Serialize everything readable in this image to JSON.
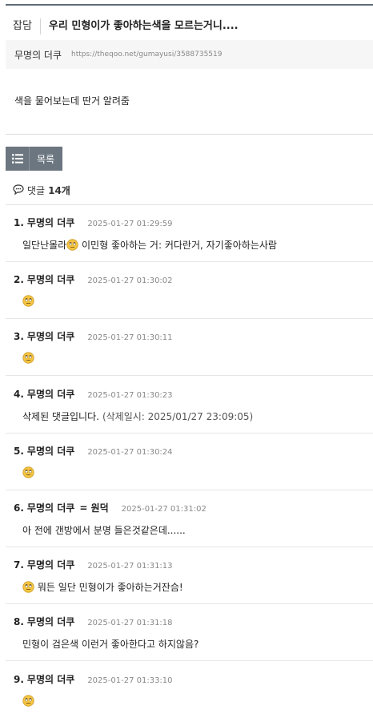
{
  "post": {
    "category": "잡담",
    "title": "우리 민형이가 좋아하는색을 모르는거니....",
    "author": "무명의 더쿠",
    "url": "https://theqoo.net/gumayusi/3588735519",
    "content": "색을 물어보는데 딴거 알려줌"
  },
  "toolbar": {
    "list_icon": "list-icon",
    "list_label": "목록"
  },
  "comments_header": {
    "icon": "comment-bubble-icon",
    "label": "댓글",
    "count": "14개"
  },
  "colors": {
    "topline": "#5f6b7a",
    "button_bg": "#6c7680",
    "emoji_face": "#f5c542"
  },
  "comments": [
    {
      "no": "1.",
      "author": "무명의 더쿠",
      "badge": "",
      "date": "2025-01-27 01:29:59",
      "text_before": "일단난몰라",
      "emoji": "face-with-rolling-eyes-icon",
      "text_after": " 이민형 좋아하는 거: 커다란거, 자기좋아하는사람"
    },
    {
      "no": "2.",
      "author": "무명의 더쿠",
      "badge": "",
      "date": "2025-01-27 01:30:02",
      "text_before": "",
      "emoji": "face-with-rolling-eyes-icon",
      "text_after": ""
    },
    {
      "no": "3.",
      "author": "무명의 더쿠",
      "badge": "",
      "date": "2025-01-27 01:30:11",
      "text_before": "",
      "emoji": "face-with-rolling-eyes-icon",
      "text_after": ""
    },
    {
      "no": "4.",
      "author": "무명의 더쿠",
      "badge": "",
      "date": "2025-01-27 01:30:23",
      "text_before": "삭제된 댓글입니다.",
      "emoji": "",
      "text_after": "",
      "deleted_note": "(삭제일시: 2025/01/27 23:09:05)"
    },
    {
      "no": "5.",
      "author": "무명의 더쿠",
      "badge": "",
      "date": "2025-01-27 01:30:24",
      "text_before": "",
      "emoji": "face-with-rolling-eyes-icon",
      "text_after": ""
    },
    {
      "no": "6.",
      "author": "무명의 더쿠",
      "badge": "= 원덕",
      "date": "2025-01-27 01:31:02",
      "text_before": "아 전에 갠방에서 분명 들은것같은데......",
      "emoji": "",
      "text_after": ""
    },
    {
      "no": "7.",
      "author": "무명의 더쿠",
      "badge": "",
      "date": "2025-01-27 01:31:13",
      "text_before": "",
      "emoji": "face-with-rolling-eyes-icon",
      "text_after": " 뭐든 일단 민형이가 좋아하는거잔슴!"
    },
    {
      "no": "8.",
      "author": "무명의 더쿠",
      "badge": "",
      "date": "2025-01-27 01:31:18",
      "text_before": "민형이 검은색 이런거 좋아한다고 하지않음?",
      "emoji": "",
      "text_after": ""
    },
    {
      "no": "9.",
      "author": "무명의 더쿠",
      "badge": "",
      "date": "2025-01-27 01:33:10",
      "text_before": "",
      "emoji": "face-with-rolling-eyes-icon",
      "text_after": ""
    }
  ]
}
